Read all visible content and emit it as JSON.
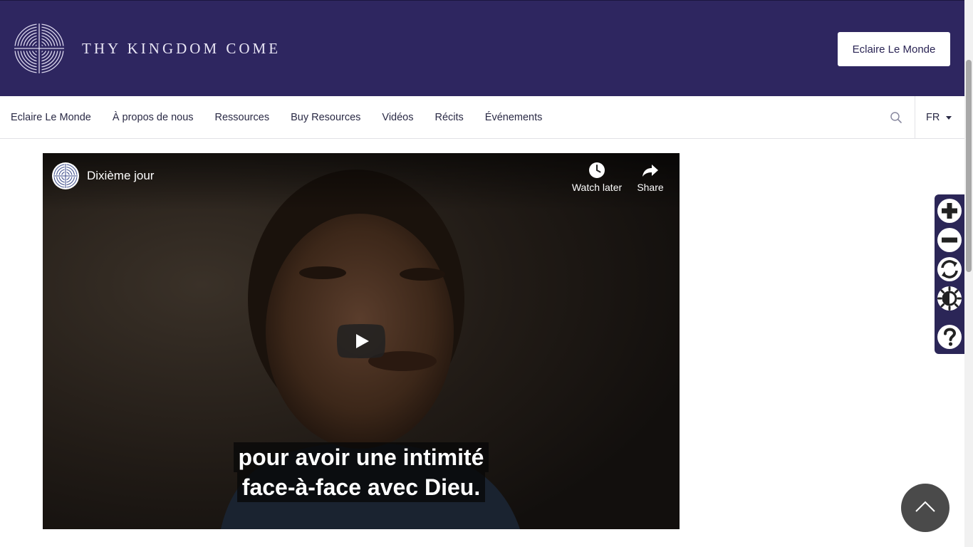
{
  "header": {
    "brand": "THY KINGDOM COME",
    "cta_label": "Eclaire Le Monde",
    "logo_icon": "concentric-cross-logo-icon"
  },
  "nav": {
    "items": [
      "Eclaire Le Monde",
      "À propos de nous",
      "Ressources",
      "Buy Resources",
      "Vidéos",
      "Récits",
      "Événements"
    ],
    "search_icon": "search-icon",
    "language": "FR"
  },
  "video": {
    "title": "Dixième jour",
    "watch_later": "Watch later",
    "share": "Share",
    "subtitle_lines": [
      "pour avoir une intimité",
      "face-à-face avec Dieu."
    ]
  },
  "accessibility_toolbar": {
    "icons": [
      "zoom-in-icon",
      "zoom-out-icon",
      "reset-icon",
      "contrast-icon",
      "help-icon"
    ]
  },
  "back_to_top_icon": "chevron-up-icon",
  "colors": {
    "header_bg": "#2e2660",
    "toolbar_bg": "#2b2657",
    "back_to_top_bg": "#4a4a4a"
  }
}
